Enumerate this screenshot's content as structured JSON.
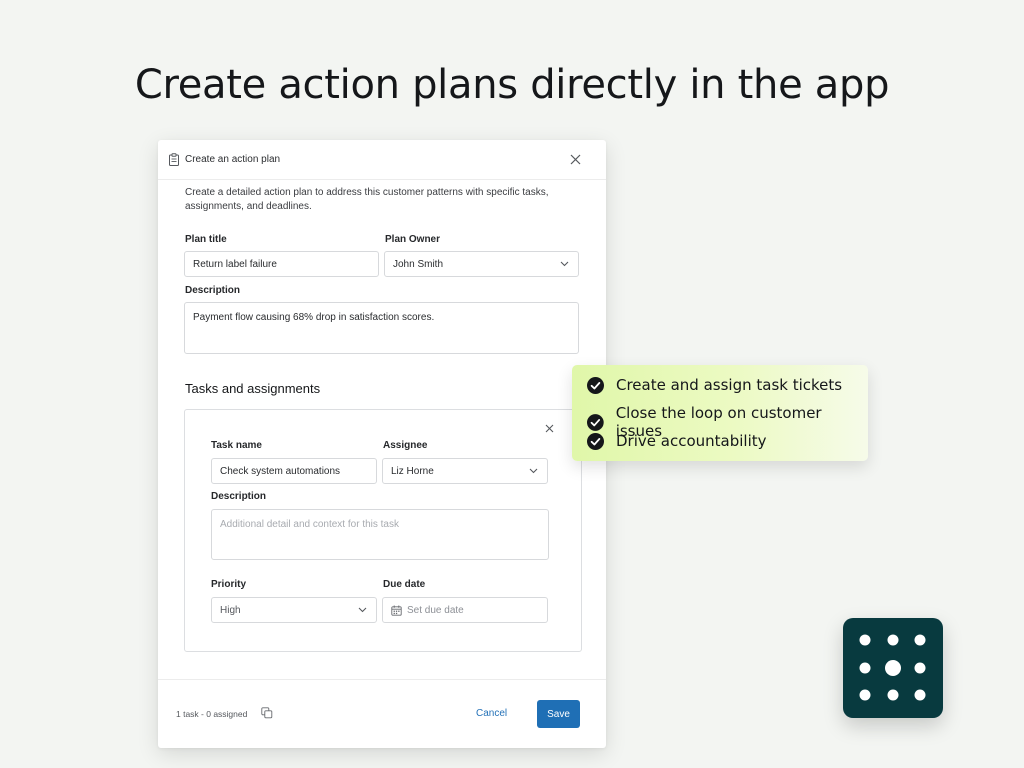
{
  "headline": "Create action plans directly in the app",
  "modal": {
    "title": "Create an action plan",
    "intro": "Create a detailed action plan to address this customer patterns with specific tasks, assignments, and deadlines.",
    "plan_title_label": "Plan title",
    "plan_title_value": "Return label failure",
    "plan_owner_label": "Plan Owner",
    "plan_owner_value": "John Smith",
    "description_label": "Description",
    "description_value": "Payment flow causing 68% drop in satisfaction scores.",
    "tasks_section_title": "Tasks and assignments",
    "task": {
      "task_name_label": "Task name",
      "task_name_value": "Check system automations",
      "assignee_label": "Assignee",
      "assignee_value": "Liz Horne",
      "description_label": "Description",
      "description_placeholder": "Additional detail and context for this task",
      "priority_label": "Priority",
      "priority_value": "High",
      "due_date_label": "Due date",
      "due_date_placeholder": "Set due date"
    },
    "footer": {
      "status": "1 task - 0 assigned",
      "cancel_label": "Cancel",
      "save_label": "Save"
    }
  },
  "callout": {
    "items": [
      "Create and assign task tickets",
      "Close the loop on customer issues",
      "Drive accountability"
    ]
  },
  "colors": {
    "accent": "#1f6fb5",
    "callout_green": "#e0f7a9",
    "logo_bg": "#083a3f"
  }
}
